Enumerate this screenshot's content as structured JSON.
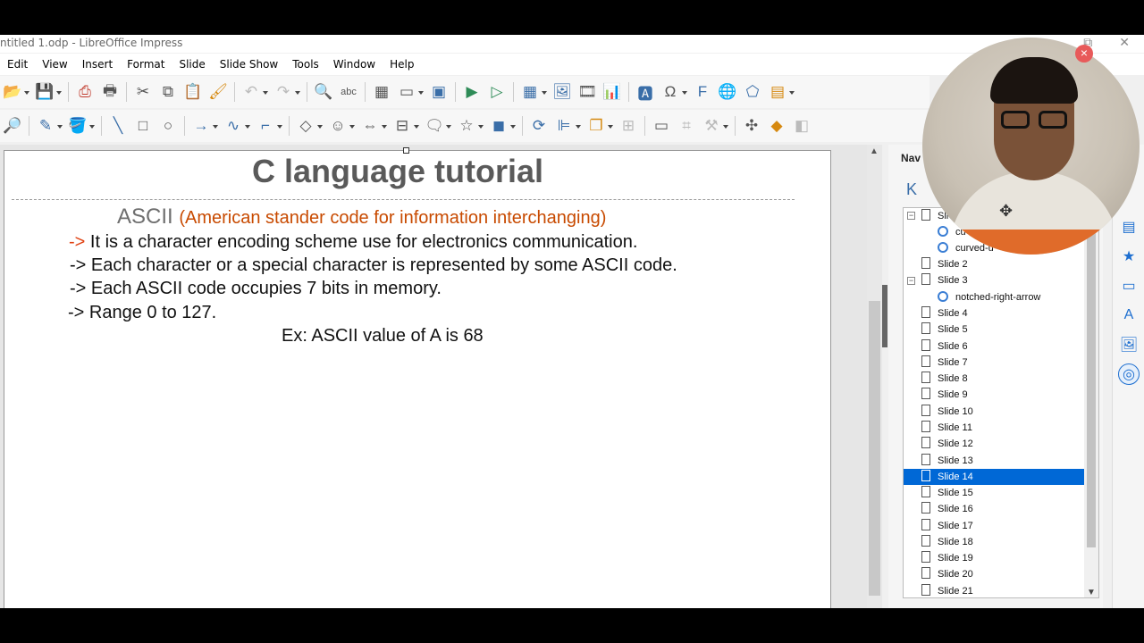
{
  "window": {
    "title": "ntitled 1.odp - LibreOffice Impress",
    "controls": [
      "⧉",
      "✕"
    ]
  },
  "menu": [
    "Edit",
    "View",
    "Insert",
    "Format",
    "Slide",
    "Slide Show",
    "Tools",
    "Window",
    "Help"
  ],
  "toolbar1_icons": [
    "open-icon",
    "save-icon",
    "export-pdf-icon",
    "print-icon",
    "cut-icon",
    "copy-icon",
    "paste-icon",
    "clone-format-icon",
    "undo-icon",
    "redo-icon",
    "find-icon",
    "spelling-icon",
    "grid-icon",
    "display-views-icon",
    "master-slide-icon",
    "start-first-icon",
    "start-current-icon",
    "table-icon",
    "image-icon",
    "media-icon",
    "chart-icon",
    "textbox-icon",
    "special-char-icon",
    "fontwork-icon",
    "hyperlink-icon",
    "show-draw-functions-icon",
    "new-slide-icon"
  ],
  "toolbar2_icons": [
    "zoom-icon",
    "line-color-icon",
    "fill-color-icon",
    "line-icon",
    "rectangle-icon",
    "ellipse-icon",
    "arrow-line-icon",
    "curve-icon",
    "connector-icon",
    "basic-shapes-icon",
    "symbol-shapes-icon",
    "block-arrows-icon",
    "flowchart-icon",
    "callouts-icon",
    "stars-icon",
    "3d-objects-icon",
    "rotate-icon",
    "align-icon",
    "arrange-icon",
    "distribute-icon",
    "shadow-icon",
    "crop-icon",
    "filter-icon",
    "points-icon",
    "glue-points-icon",
    "toggle-extrusion-icon"
  ],
  "slide": {
    "title": "C language tutorial",
    "ascii_word": "ASCII",
    "ascii_expansion": "(American stander code for information interchanging)",
    "bullet1_arrow": "->",
    "bullet1_text": " It is a character encoding scheme use for electronics communication.",
    "bullet2": "-> Each character or a special character is represented by some ASCII code.",
    "bullet3": "-> Each ASCII code occupies 7 bits in memory.",
    "bullet4": "-> Range 0 to 127.",
    "example": "Ex:  ASCII value of A is 68"
  },
  "navigator": {
    "title": "Nav",
    "items": [
      {
        "label": "Sli",
        "kind": "slide",
        "expanded": true
      },
      {
        "label": "cu",
        "kind": "shape"
      },
      {
        "label": "curved-u",
        "kind": "shape"
      },
      {
        "label": "Slide 2",
        "kind": "slide"
      },
      {
        "label": "Slide 3",
        "kind": "slide",
        "expanded": true
      },
      {
        "label": "notched-right-arrow",
        "kind": "shape"
      },
      {
        "label": "Slide 4",
        "kind": "slide"
      },
      {
        "label": "Slide 5",
        "kind": "slide"
      },
      {
        "label": "Slide 6",
        "kind": "slide"
      },
      {
        "label": "Slide 7",
        "kind": "slide"
      },
      {
        "label": "Slide 8",
        "kind": "slide"
      },
      {
        "label": "Slide 9",
        "kind": "slide"
      },
      {
        "label": "Slide 10",
        "kind": "slide"
      },
      {
        "label": "Slide 11",
        "kind": "slide"
      },
      {
        "label": "Slide 12",
        "kind": "slide"
      },
      {
        "label": "Slide 13",
        "kind": "slide"
      },
      {
        "label": "Slide 14",
        "kind": "slide",
        "selected": true
      },
      {
        "label": "Slide 15",
        "kind": "slide"
      },
      {
        "label": "Slide 16",
        "kind": "slide"
      },
      {
        "label": "Slide 17",
        "kind": "slide"
      },
      {
        "label": "Slide 18",
        "kind": "slide"
      },
      {
        "label": "Slide 19",
        "kind": "slide"
      },
      {
        "label": "Slide 20",
        "kind": "slide"
      },
      {
        "label": "Slide 21",
        "kind": "slide"
      }
    ]
  },
  "sidebar_tabs": [
    "properties-icon",
    "slide-transition-icon",
    "animation-icon",
    "master-slides-icon",
    "styles-icon",
    "gallery-icon",
    "navigator-icon"
  ],
  "colors": {
    "title_gray": "#5a5a5a",
    "accent_orange": "#c84a00",
    "selection_blue": "#0068d6"
  }
}
